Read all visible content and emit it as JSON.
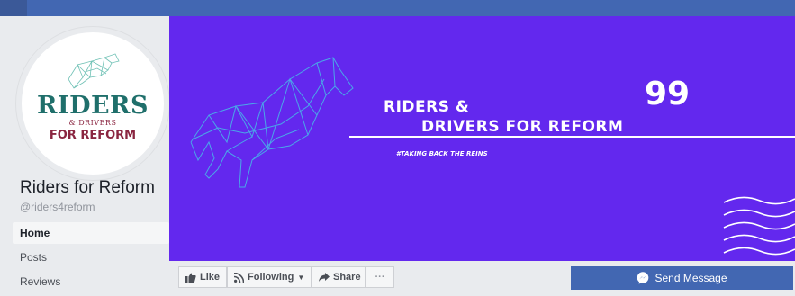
{
  "colors": {
    "cover_bg": "#6328ee",
    "accent": "#4267b2",
    "line_art": "#4aa8e8",
    "logo_teal": "#1f6f6b",
    "logo_maroon": "#8a2540"
  },
  "logo": {
    "line1": "RIDERS",
    "line2": "& DRIVERS",
    "line3": "FOR REFORM"
  },
  "page": {
    "name": "Riders for Reform",
    "handle": "@riders4reform"
  },
  "nav": {
    "items": [
      {
        "label": "Home",
        "active": true
      },
      {
        "label": "Posts"
      },
      {
        "label": "Reviews"
      }
    ]
  },
  "cover": {
    "quote_mark": "99",
    "title_line1": "RIDERS &",
    "title_line2": "DRIVERS FOR REFORM",
    "hashtag": "#TAKING BACK THE REINS"
  },
  "actions": {
    "like": "Like",
    "following": "Following",
    "share": "Share",
    "more": "···",
    "send_message": "Send Message"
  },
  "icons": {
    "like": "thumbs-up-icon",
    "following": "rss-icon",
    "share": "share-arrow-icon",
    "send": "messenger-icon"
  }
}
